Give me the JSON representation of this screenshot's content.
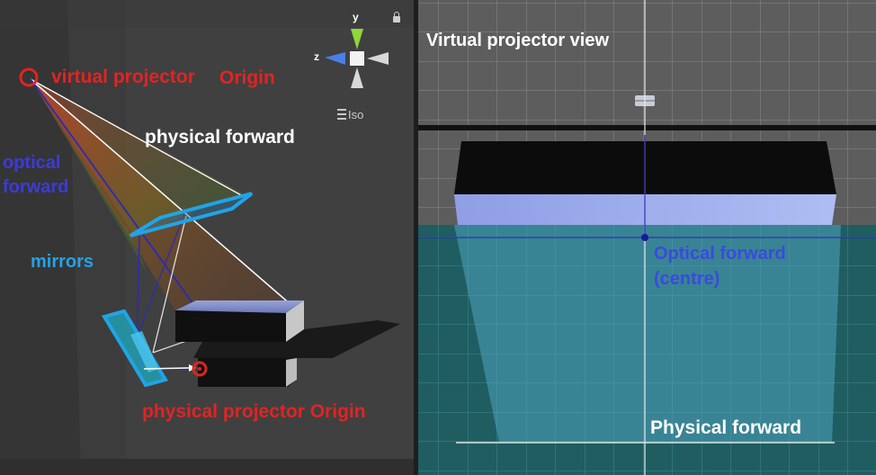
{
  "left_view": {
    "virtual_projector_label": "virtual projector",
    "virtual_origin_label": "Origin",
    "physical_forward_label": "physical forward",
    "optical_forward_line1": "optical",
    "optical_forward_line2": "forward",
    "mirrors_label": "mirrors",
    "physical_projector_label": "physical projector Origin",
    "gizmo": {
      "y": "y",
      "z": "z",
      "mode": "Iso"
    }
  },
  "right_view": {
    "title": "Virtual projector view",
    "optical_forward_line1": "Optical forward",
    "optical_forward_line2": "(centre)",
    "physical_forward_label": "Physical forward"
  },
  "colors": {
    "red_marker": "#e02424",
    "optical_blue": "#3b3bdc",
    "mirror_cyan": "#21a4e6",
    "text_white": "#ffffff"
  },
  "icons": [
    "orientation-gizmo-icon",
    "lock-icon",
    "menu-icon"
  ]
}
